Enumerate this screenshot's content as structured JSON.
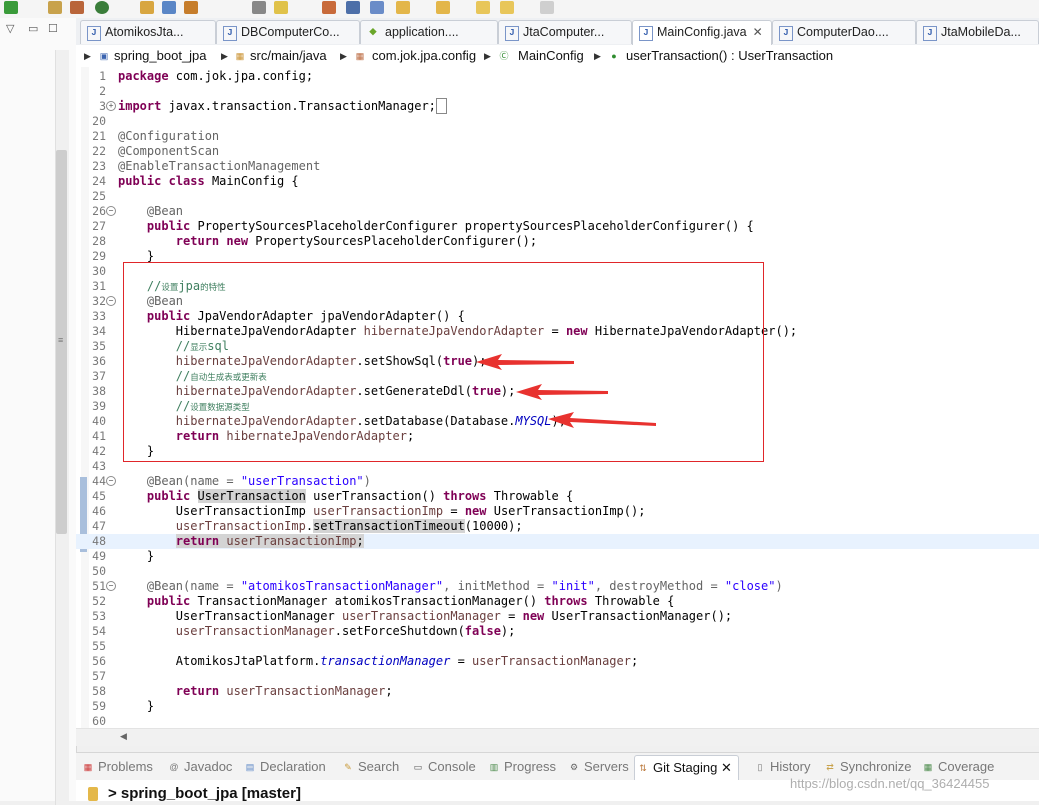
{
  "editor_tabs": [
    {
      "label": "AtomikosJta...",
      "icon": "java-file-icon",
      "active": false
    },
    {
      "label": "DBComputerCo...",
      "icon": "java-file-icon",
      "active": false
    },
    {
      "label": "application....",
      "icon": "properties-file-icon",
      "active": false
    },
    {
      "label": "JtaComputer...",
      "icon": "java-file-icon",
      "active": false
    },
    {
      "label": "MainConfig.java",
      "icon": "java-file-icon",
      "active": true,
      "close": "✕"
    },
    {
      "label": "ComputerDao....",
      "icon": "java-file-icon",
      "active": false
    },
    {
      "label": "JtaMobileDa...",
      "icon": "java-file-icon",
      "active": false
    }
  ],
  "breadcrumb": {
    "project": "spring_boot_jpa",
    "source_folder": "src/main/java",
    "package": "com.jok.jpa.config",
    "class": "MainConfig",
    "member": "userTransaction() : UserTransaction"
  },
  "code": {
    "l1": {
      "n": "1",
      "kw": "package",
      "rest": " com.jok.jpa.config;"
    },
    "l2": {
      "n": "2"
    },
    "l3": {
      "n": "3",
      "kw": "import",
      "rest": " javax.transaction.TransactionManager;"
    },
    "l20": {
      "n": "20"
    },
    "l21": {
      "n": "21",
      "text": "@Configuration"
    },
    "l22": {
      "n": "22",
      "text": "@ComponentScan"
    },
    "l23": {
      "n": "23",
      "text": "@EnableTransactionManagement"
    },
    "l24": {
      "n": "24",
      "kw1": "public",
      "kw2": "class",
      "rest": " MainConfig {"
    },
    "l25": {
      "n": "25"
    },
    "l26": {
      "n": "26",
      "text": "@Bean"
    },
    "l27": {
      "n": "27",
      "kw": "public",
      "rest": " PropertySourcesPlaceholderConfigurer propertySourcesPlaceholderConfigurer() {"
    },
    "l28": {
      "n": "28",
      "kw1": "return",
      "kw2": "new",
      "rest": " PropertySourcesPlaceholderConfigurer();"
    },
    "l29": {
      "n": "29",
      "text": "}"
    },
    "l30": {
      "n": "30"
    },
    "l31": {
      "n": "31",
      "prefix": "//",
      "cn": "设置",
      "mid": "jpa",
      "cn2": "的特性"
    },
    "l32": {
      "n": "32",
      "text": "@Bean"
    },
    "l33": {
      "n": "33",
      "kw": "public",
      "rest": " JpaVendorAdapter jpaVendorAdapter() {"
    },
    "l34": {
      "n": "34",
      "type": "HibernateJpaVendorAdapter ",
      "var": "hibernateJpaVendorAdapter",
      "eq": " = ",
      "kw": "new",
      "rest": " HibernateJpaVendorAdapter();"
    },
    "l35": {
      "n": "35",
      "prefix": "//",
      "cn": "显示",
      "mid": "sql"
    },
    "l36": {
      "n": "36",
      "var": "hibernateJpaVendorAdapter",
      "call": ".setShowSql(",
      "kw": "true",
      "end": ");"
    },
    "l37": {
      "n": "37",
      "prefix": "//",
      "cn": "自动生成表或更新表"
    },
    "l38": {
      "n": "38",
      "var": "hibernateJpaVendorAdapter",
      "call": ".setGenerateDdl(",
      "kw": "true",
      "end": ");"
    },
    "l39": {
      "n": "39",
      "prefix": "//",
      "cn": "设置数据源类型"
    },
    "l40": {
      "n": "40",
      "var": "hibernateJpaVendorAdapter",
      "call": ".setDatabase(Database.",
      "const": "MYSQL",
      "end": ");"
    },
    "l41": {
      "n": "41",
      "kw": "return",
      "var": " hibernateJpaVendorAdapter",
      "end": ";"
    },
    "l42": {
      "n": "42",
      "text": "}"
    },
    "l43": {
      "n": "43"
    },
    "l44": {
      "n": "44",
      "ann": "@Bean(name = ",
      "str": "\"userTransaction\"",
      "end": ")"
    },
    "l45": {
      "n": "45",
      "kw": "public",
      "type": "UserTransaction",
      "mid": " userTransaction() ",
      "kw2": "throws",
      "rest": " Throwable {"
    },
    "l46": {
      "n": "46",
      "type": "UserTransactionImp ",
      "var": "userTransactionImp",
      "eq": " = ",
      "kw": "new",
      "rest": " UserTransactionImp();"
    },
    "l47": {
      "n": "47",
      "var": "userTransactionImp",
      "dot": ".",
      "call": "setTransactionTimeout",
      "rest": "(10000);"
    },
    "l48": {
      "n": "48",
      "kw": "return",
      "var": " userTransactionImp",
      "end": ";"
    },
    "l49": {
      "n": "49",
      "text": "}"
    },
    "l50": {
      "n": "50"
    },
    "l51": {
      "n": "51",
      "ann": "@Bean(name = ",
      "str1": "\"atomikosTransactionManager\"",
      "p2": ", initMethod = ",
      "str2": "\"init\"",
      "p3": ", destroyMethod = ",
      "str3": "\"close\"",
      "end": ")"
    },
    "l52": {
      "n": "52",
      "kw": "public",
      "mid": " TransactionManager atomikosTransactionManager() ",
      "kw2": "throws",
      "rest": " Throwable {"
    },
    "l53": {
      "n": "53",
      "type": "UserTransactionManager ",
      "var": "userTransactionManager",
      "eq": " = ",
      "kw": "new",
      "rest": " UserTransactionManager();"
    },
    "l54": {
      "n": "54",
      "var": "userTransactionManager",
      "call": ".setForceShutdown(",
      "kw": "false",
      "end": ");"
    },
    "l55": {
      "n": "55"
    },
    "l56": {
      "n": "56",
      "pre": "AtomikosJtaPlatform.",
      "ital": "transactionManager",
      "eq": " = ",
      "var": "userTransactionManager",
      "end": ";"
    },
    "l57": {
      "n": "57"
    },
    "l58": {
      "n": "58",
      "kw": "return",
      "var": " userTransactionManager",
      "end": ";"
    },
    "l59": {
      "n": "59",
      "text": "}"
    },
    "l60": {
      "n": "60"
    }
  },
  "bottom_tabs": [
    {
      "label": "Problems",
      "icon": "problems-icon"
    },
    {
      "label": "Javadoc",
      "icon": "javadoc-icon"
    },
    {
      "label": "Declaration",
      "icon": "declaration-icon"
    },
    {
      "label": "Search",
      "icon": "search-icon"
    },
    {
      "label": "Console",
      "icon": "console-icon"
    },
    {
      "label": "Progress",
      "icon": "progress-icon"
    },
    {
      "label": "Servers",
      "icon": "servers-icon"
    },
    {
      "label": "Git Staging",
      "icon": "git-staging-icon",
      "active": true,
      "close": "✕"
    },
    {
      "label": "History",
      "icon": "history-icon"
    },
    {
      "label": "Synchronize",
      "icon": "synchronize-icon"
    },
    {
      "label": "Coverage",
      "icon": "coverage-icon"
    }
  ],
  "status": {
    "repo": "> spring_boot_jpa [master]"
  },
  "watermark": "https://blog.csdn.net/qq_36424455",
  "colors": {
    "keyword": "#7f0055",
    "annotation": "#646464",
    "comment": "#3f7f5f",
    "string": "#2a00ff",
    "field": "#6a3e3e",
    "highlight_box": "#e0262a"
  }
}
